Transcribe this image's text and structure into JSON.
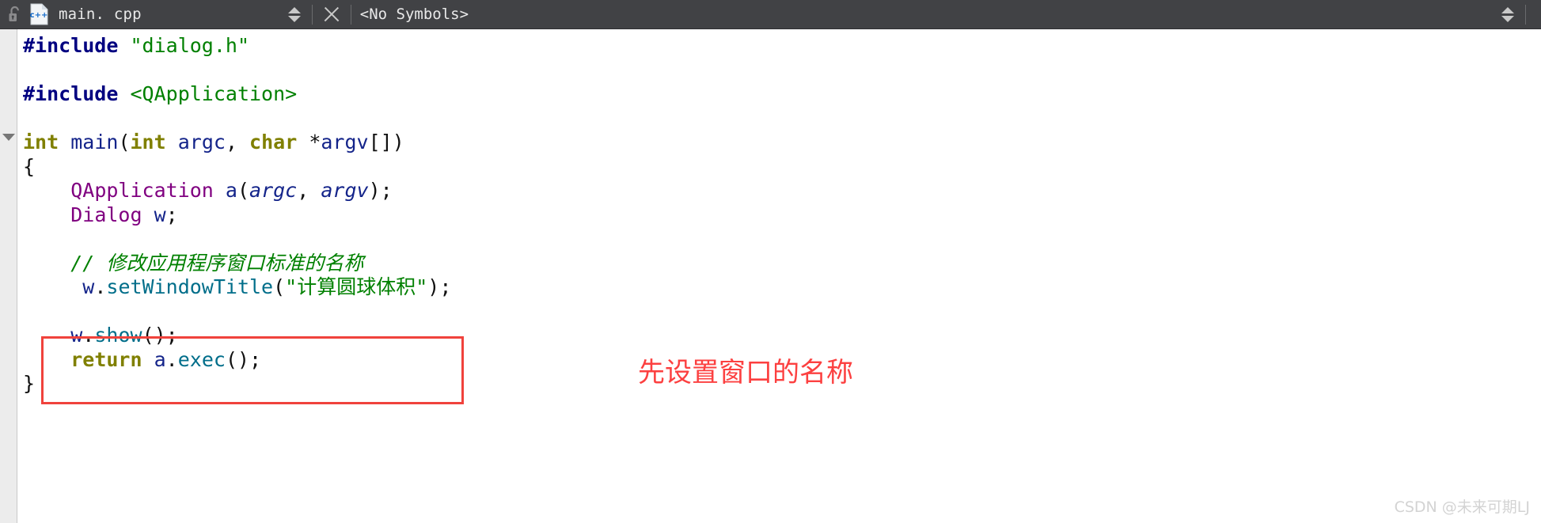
{
  "toolbar": {
    "lock_icon": "unlock-icon",
    "file_icon": "cpp-file-icon",
    "filename": "main. cpp",
    "nav_arrows_icon": "up-down-arrows-icon",
    "close_icon": "close-x-icon",
    "symbols_label": "<No Symbols>",
    "right_arrows_icon": "up-down-arrows-icon",
    "background_color": "#414245",
    "text_color": "#e9e9e9"
  },
  "editor": {
    "gutter": {
      "background_color": "#ececec",
      "fold_marker_icon": "collapse-triangle-icon"
    },
    "background_color": "#ffffff",
    "lines": [
      {
        "id": "line-include-dialog",
        "tokens": [
          {
            "cls": "t-pre",
            "text": "#include"
          },
          {
            "cls": "t-punct",
            "text": " "
          },
          {
            "cls": "t-inc",
            "text": "\"dialog.h\""
          }
        ]
      },
      {
        "id": "line-blank-1",
        "tokens": []
      },
      {
        "id": "line-include-qapplication",
        "tokens": [
          {
            "cls": "t-pre",
            "text": "#include"
          },
          {
            "cls": "t-punct",
            "text": " "
          },
          {
            "cls": "t-inc",
            "text": "<QApplication>"
          }
        ]
      },
      {
        "id": "line-blank-2",
        "tokens": []
      },
      {
        "id": "line-main-signature",
        "tokens": [
          {
            "cls": "t-kw",
            "text": "int"
          },
          {
            "cls": "t-punct",
            "text": " "
          },
          {
            "cls": "t-plain",
            "text": "main"
          },
          {
            "cls": "t-punct",
            "text": "("
          },
          {
            "cls": "t-kw",
            "text": "int"
          },
          {
            "cls": "t-punct",
            "text": " "
          },
          {
            "cls": "t-plain",
            "text": "argc"
          },
          {
            "cls": "t-punct",
            "text": ", "
          },
          {
            "cls": "t-kw",
            "text": "char"
          },
          {
            "cls": "t-punct",
            "text": " *"
          },
          {
            "cls": "t-plain",
            "text": "argv"
          },
          {
            "cls": "t-punct",
            "text": "[])"
          }
        ]
      },
      {
        "id": "line-open-brace",
        "tokens": [
          {
            "cls": "t-punct",
            "text": "{"
          }
        ]
      },
      {
        "id": "line-qapplication-decl",
        "tokens": [
          {
            "cls": "t-punct",
            "text": "    "
          },
          {
            "cls": "t-type",
            "text": "QApplication"
          },
          {
            "cls": "t-punct",
            "text": " "
          },
          {
            "cls": "t-plain",
            "text": "a"
          },
          {
            "cls": "t-punct",
            "text": "("
          },
          {
            "cls": "t-param",
            "text": "argc"
          },
          {
            "cls": "t-punct",
            "text": ", "
          },
          {
            "cls": "t-param",
            "text": "argv"
          },
          {
            "cls": "t-punct",
            "text": ");"
          }
        ]
      },
      {
        "id": "line-dialog-decl",
        "tokens": [
          {
            "cls": "t-punct",
            "text": "    "
          },
          {
            "cls": "t-type",
            "text": "Dialog"
          },
          {
            "cls": "t-punct",
            "text": " "
          },
          {
            "cls": "t-plain",
            "text": "w"
          },
          {
            "cls": "t-punct",
            "text": ";"
          }
        ]
      },
      {
        "id": "line-blank-3",
        "tokens": []
      },
      {
        "id": "line-comment-set-title",
        "tokens": [
          {
            "cls": "t-punct",
            "text": "    "
          },
          {
            "cls": "t-cmt",
            "text": "// 修改应用程序窗口标准的名称"
          }
        ]
      },
      {
        "id": "line-set-window-title",
        "tokens": [
          {
            "cls": "t-punct",
            "text": "     "
          },
          {
            "cls": "t-plain",
            "text": "w"
          },
          {
            "cls": "t-punct",
            "text": "."
          },
          {
            "cls": "t-func",
            "text": "setWindowTitle"
          },
          {
            "cls": "t-punct",
            "text": "("
          },
          {
            "cls": "t-str",
            "text": "\"计算圆球体积\""
          },
          {
            "cls": "t-punct",
            "text": ");"
          }
        ]
      },
      {
        "id": "line-blank-4",
        "tokens": []
      },
      {
        "id": "line-show",
        "tokens": [
          {
            "cls": "t-punct",
            "text": "    "
          },
          {
            "cls": "t-plain",
            "text": "w"
          },
          {
            "cls": "t-punct",
            "text": "."
          },
          {
            "cls": "t-func",
            "text": "show"
          },
          {
            "cls": "t-punct",
            "text": "();"
          }
        ]
      },
      {
        "id": "line-return-exec",
        "tokens": [
          {
            "cls": "t-punct",
            "text": "    "
          },
          {
            "cls": "t-kw",
            "text": "return"
          },
          {
            "cls": "t-punct",
            "text": " "
          },
          {
            "cls": "t-plain",
            "text": "a"
          },
          {
            "cls": "t-punct",
            "text": "."
          },
          {
            "cls": "t-func",
            "text": "exec"
          },
          {
            "cls": "t-punct",
            "text": "();"
          }
        ]
      },
      {
        "id": "line-close-brace",
        "tokens": [
          {
            "cls": "t-punct",
            "text": "}"
          }
        ]
      }
    ]
  },
  "highlight_box": {
    "color": "#f0423c"
  },
  "annotation": {
    "text": "先设置窗口的名称",
    "color": "#fc4040"
  },
  "watermark": {
    "text": "CSDN @未来可期LJ",
    "color": "#d3d3d3"
  }
}
